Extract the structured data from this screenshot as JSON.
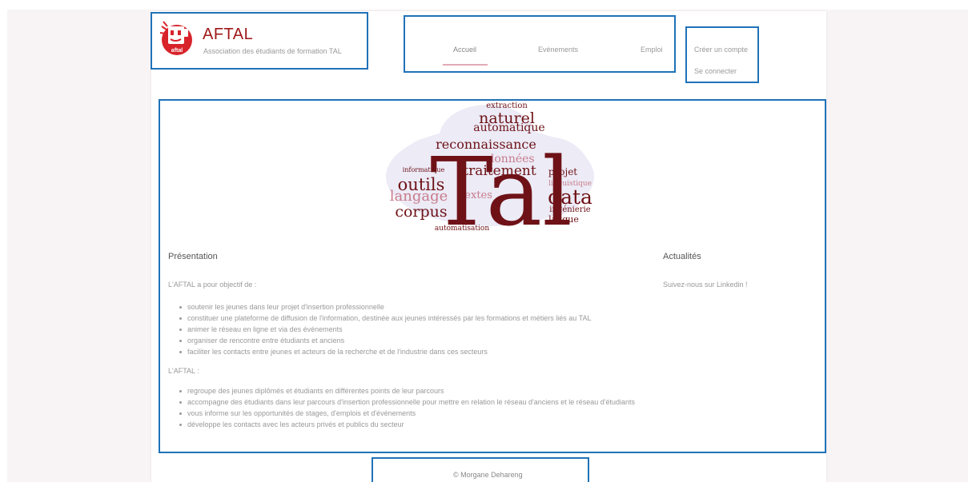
{
  "brand": {
    "logo_text": "aftal",
    "title": "AFTAL",
    "subtitle": "Association des étudiants de formation TAL",
    "color": "#a01818"
  },
  "nav": {
    "items": [
      {
        "label": "Accueil",
        "active": true
      },
      {
        "label": "Evénements",
        "active": false
      },
      {
        "label": "Emploi",
        "active": false
      }
    ],
    "active_color": "#e2aab9"
  },
  "account": {
    "create_label": "Créer un compte",
    "login_label": "Se connecter"
  },
  "wordcloud": {
    "big_word": "Tal",
    "words": [
      "extraction",
      "naturel",
      "automatique",
      "reconnaissance",
      "données",
      "informatique",
      "traitement",
      "projet",
      "linguistique",
      "outils",
      "langage",
      "textes",
      "data",
      "ingénierie",
      "corpus",
      "langue",
      "automatisation"
    ],
    "dark_color": "#6e1217",
    "light_color": "#c87c8c"
  },
  "presentation": {
    "title": "Présentation",
    "intro": "L'AFTAL a pour objectif de :",
    "objectives": [
      "soutenir les jeunes dans leur projet d'insertion professionnelle",
      "constituer une plateforme de diffusion de l'information, destinée aux jeunes intéressés par les formations et métiers liés au TAL",
      "animer le réseau en ligne et via des événements",
      "organiser de rencontre entre étudiants et anciens",
      "faciliter les contacts entre jeunes et acteurs de la recherche et de l'industrie dans ces secteurs"
    ],
    "intro2": "L'AFTAL :",
    "features": [
      "regroupe des jeunes diplômés et étudiants en différentes points de leur parcours",
      "accompagne des étudiants dans leur parcours d'insertion professionnelle pour mettre en relation le réseau d'anciens et le réseau d'étudiants",
      "vous informe sur les opportunités de stages, d'emplois et d'événements",
      "développe les contacts avec les acteurs privés et publics du secteur"
    ]
  },
  "news": {
    "title": "Actualités",
    "text": "Suivez-nous sur Linkedin !"
  },
  "footer": {
    "text": "© Morgane Dehareng"
  }
}
